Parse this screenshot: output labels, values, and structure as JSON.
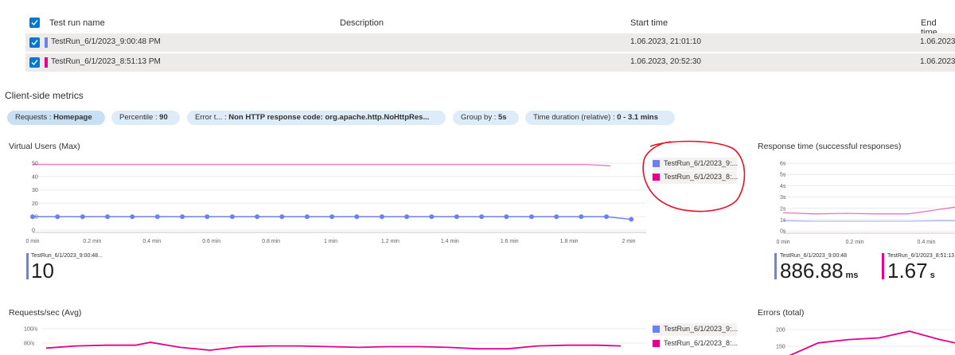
{
  "table": {
    "columns": {
      "name": "Test run name",
      "description": "Description",
      "start": "Start time",
      "end": "End time"
    },
    "rows": [
      {
        "name": "TestRun_6/1/2023_9:00:48 PM",
        "description": "",
        "start": "1.06.2023, 21:01:10",
        "end": "1.06.2023,",
        "color": "#6b82e8"
      },
      {
        "name": "TestRun_6/1/2023_8:51:13 PM",
        "description": "",
        "start": "1.06.2023, 20:52:30",
        "end": "1.06.2023,",
        "color": "#e3008c"
      }
    ]
  },
  "metrics_section": {
    "title": "Client-side metrics"
  },
  "filters": [
    {
      "label": "Requests : ",
      "value": "Homepage"
    },
    {
      "label": "Percentile : ",
      "value": "90"
    },
    {
      "label": "Error t... : ",
      "value": "Non HTTP response code: org.apache.http.NoHttpRes..."
    },
    {
      "label": "Group by : ",
      "value": "5s"
    },
    {
      "label": "Time duration (relative) : ",
      "value": "0 - 3.1 mins"
    }
  ],
  "legend": [
    "TestRun_6/1/2023_9:...",
    "TestRun_6/1/2023_8:..."
  ],
  "chart_data": [
    {
      "type": "line",
      "title": "Virtual Users (Max)",
      "ylim": [
        0,
        50
      ],
      "yticks": [
        "50",
        "40",
        "30",
        "20",
        "10",
        "0"
      ],
      "xticks": [
        "0 min",
        "0.2 min",
        "0.4 min",
        "0.6 min",
        "0.8 min",
        "1 min",
        "1.2 min",
        "1.4 min",
        "1.6 min",
        "1.8 min",
        "2 min"
      ],
      "xlim": [
        0,
        2.05
      ],
      "series": [
        {
          "name": "TestRun_6/1/2023_9:...",
          "color": "#6b82e8",
          "markers": true,
          "x": [
            0,
            0.083,
            0.167,
            0.25,
            0.333,
            0.417,
            0.5,
            0.583,
            0.667,
            0.75,
            0.833,
            0.917,
            1,
            1.083,
            1.167,
            1.25,
            1.333,
            1.417,
            1.5,
            1.583,
            1.667,
            1.75,
            1.833,
            1.917,
            2.0
          ],
          "values": [
            10,
            10,
            10,
            10,
            10,
            10,
            10,
            10,
            10,
            10,
            10,
            10,
            10,
            10,
            10,
            10,
            10,
            10,
            10,
            10,
            10,
            10,
            10,
            10,
            8
          ]
        },
        {
          "name": "TestRun_6/1/2023_8:...",
          "color": "#e3008c",
          "markers": false,
          "x": [
            0,
            1.85,
            1.93
          ],
          "values": [
            49,
            49,
            48
          ]
        }
      ],
      "stat": {
        "name": "TestRun_6/1/2023_9:00:48...",
        "value": "10",
        "unit": "",
        "color": "#6b82e8"
      }
    },
    {
      "type": "line",
      "title": "Response time (successful responses)",
      "ylim": [
        0,
        6
      ],
      "yticks": [
        "6s",
        "5s",
        "4s",
        "3s",
        "2s",
        "1s",
        "0s"
      ],
      "xticks": [
        "0 min",
        "0.2 min",
        "0.4 min"
      ],
      "xlim": [
        0,
        0.55
      ],
      "series": [
        {
          "name": "TestRun_6/1/2023_9:...",
          "color": "#6b82e8",
          "x": [
            0,
            0.1,
            0.2,
            0.3,
            0.4,
            0.5,
            0.55
          ],
          "values": [
            0.9,
            0.85,
            0.85,
            0.85,
            0.85,
            0.9,
            0.9
          ]
        },
        {
          "name": "TestRun_6/1/2023_8:...",
          "color": "#e3008c",
          "x": [
            0,
            0.1,
            0.2,
            0.3,
            0.4,
            0.5,
            0.55
          ],
          "values": [
            1.6,
            1.5,
            1.55,
            1.5,
            1.5,
            1.9,
            2.1
          ]
        }
      ],
      "stats": [
        {
          "name": "TestRun_6/1/2023_9:00:48",
          "value": "886.88",
          "unit": "ms",
          "color": "#6b82e8"
        },
        {
          "name": "TestRun_6/1/2023_8:51:13",
          "value": "1.67",
          "unit": "s",
          "color": "#e3008c"
        }
      ]
    },
    {
      "type": "line",
      "title": "Requests/sec (Avg)",
      "ylim": [
        60,
        100
      ],
      "yticks": [
        "100/s",
        "80/s"
      ],
      "series": [
        {
          "name": "TestRun_6/1/2023_8:...",
          "color": "#e3008c",
          "x": [
            0,
            0.1,
            0.2,
            0.3,
            0.35,
            0.45,
            0.55,
            0.65,
            0.75,
            0.85,
            0.95,
            1.05,
            1.15,
            1.25,
            1.35,
            1.45,
            1.55,
            1.65,
            1.75,
            1.85,
            1.93
          ],
          "values": [
            73,
            76,
            77,
            77,
            81,
            74,
            70,
            75,
            76,
            76,
            75,
            74,
            75,
            75,
            74,
            72,
            72,
            76,
            77,
            77,
            76
          ]
        }
      ]
    },
    {
      "type": "line",
      "title": "Errors (total)",
      "yticks": [
        "200",
        "150"
      ],
      "series": [
        {
          "name": "TestRun_6/1/2023_8:...",
          "color": "#e3008c",
          "x": [
            0,
            0.1,
            0.2,
            0.3,
            0.4,
            0.5,
            0.55
          ],
          "values": [
            120,
            160,
            170,
            175,
            195,
            170,
            160
          ]
        }
      ]
    }
  ]
}
